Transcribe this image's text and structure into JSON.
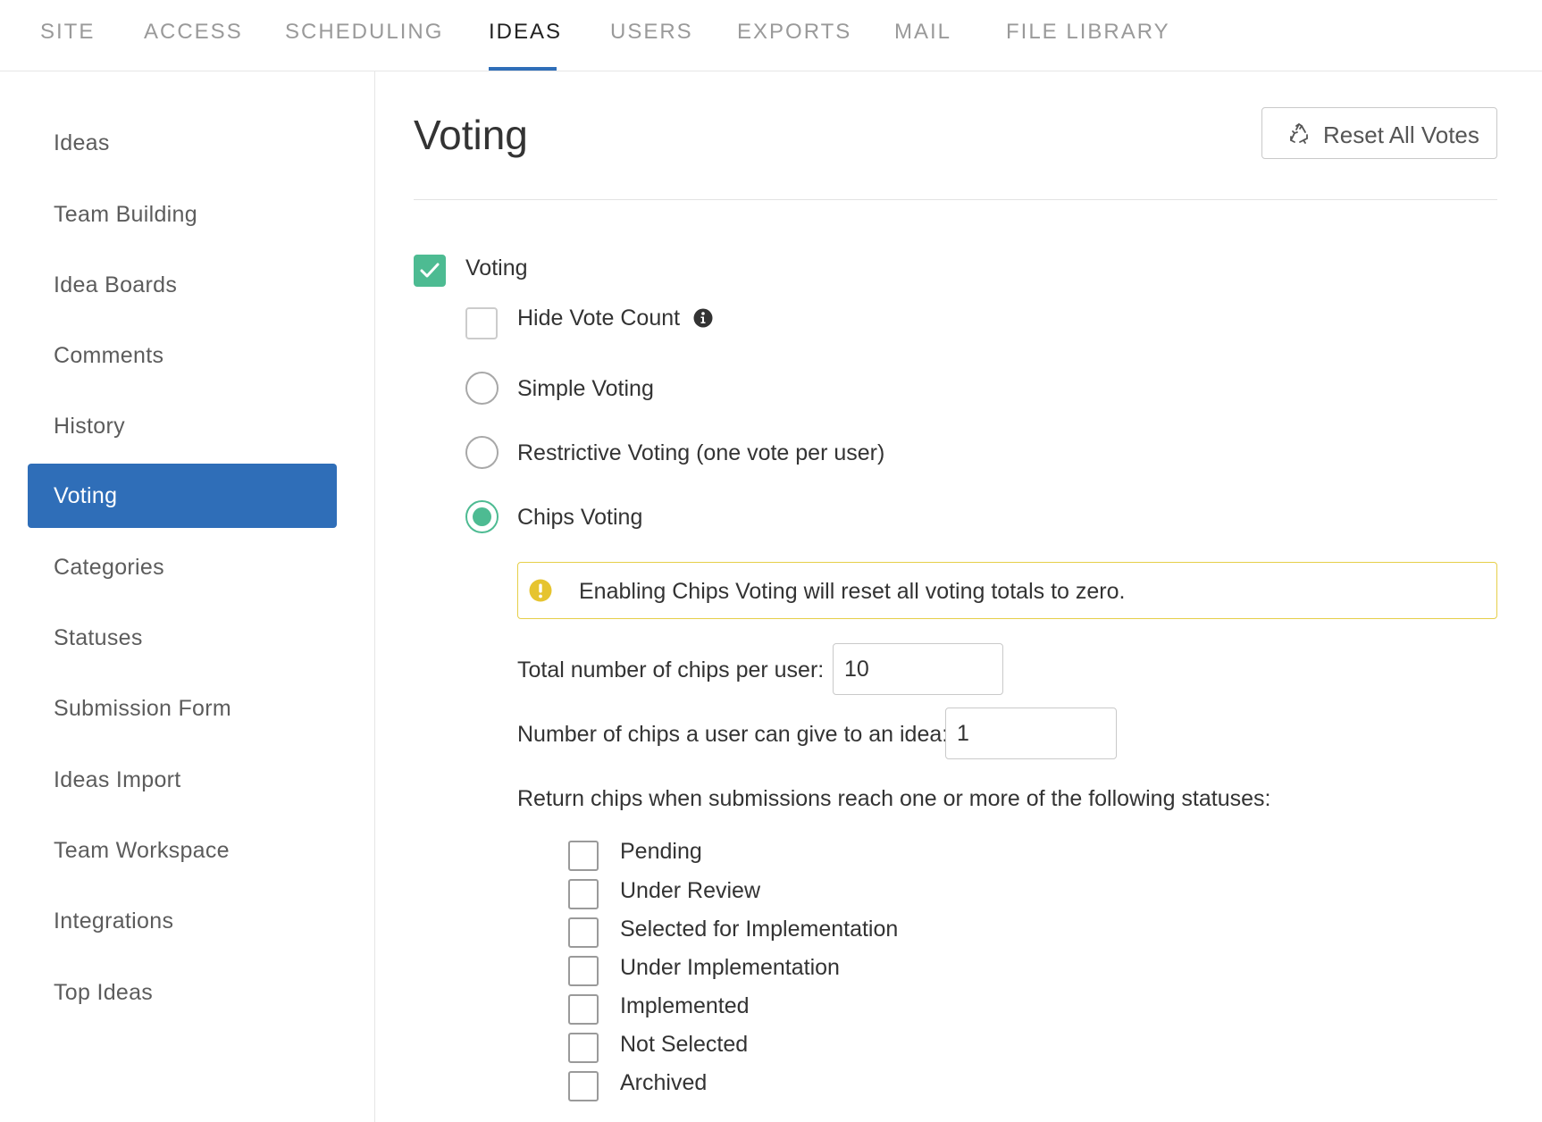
{
  "topnav": {
    "tabs": [
      {
        "label": "SITE"
      },
      {
        "label": "ACCESS"
      },
      {
        "label": "SCHEDULING"
      },
      {
        "label": "IDEAS"
      },
      {
        "label": "USERS"
      },
      {
        "label": "EXPORTS"
      },
      {
        "label": "MAIL"
      },
      {
        "label": "FILE LIBRARY"
      }
    ],
    "active_tab": "IDEAS"
  },
  "sidebar": {
    "items": [
      {
        "label": "Ideas"
      },
      {
        "label": "Team Building"
      },
      {
        "label": "Idea Boards"
      },
      {
        "label": "Comments"
      },
      {
        "label": "History"
      },
      {
        "label": "Voting"
      },
      {
        "label": "Categories"
      },
      {
        "label": "Statuses"
      },
      {
        "label": "Submission Form"
      },
      {
        "label": "Ideas Import"
      },
      {
        "label": "Team Workspace"
      },
      {
        "label": "Integrations"
      },
      {
        "label": "Top Ideas"
      }
    ],
    "active_item": "Voting"
  },
  "main": {
    "title": "Voting",
    "reset_button": "Reset All Votes",
    "voting_label": "Voting",
    "voting_checked": true,
    "hide_vote_count_label": "Hide Vote Count",
    "hide_vote_count_checked": false,
    "voting_modes": [
      {
        "label": "Simple Voting",
        "selected": false
      },
      {
        "label": "Restrictive Voting (one vote per user)",
        "selected": false
      },
      {
        "label": "Chips Voting",
        "selected": true
      }
    ],
    "warning_text": "Enabling Chips Voting will reset all voting totals to zero.",
    "chips_per_user_label": "Total number of chips per user:",
    "chips_per_user_value": "10",
    "chips_per_idea_label": "Number of chips a user can give to an idea:",
    "chips_per_idea_value": "1",
    "return_chips_label": "Return chips when submissions reach one or more of the following statuses:",
    "statuses": [
      {
        "label": "Pending",
        "checked": false
      },
      {
        "label": "Under Review",
        "checked": false
      },
      {
        "label": "Selected for Implementation",
        "checked": false
      },
      {
        "label": "Under Implementation",
        "checked": false
      },
      {
        "label": "Implemented",
        "checked": false
      },
      {
        "label": "Not Selected",
        "checked": false
      },
      {
        "label": "Archived",
        "checked": false
      }
    ]
  },
  "colors": {
    "accent_blue": "#2f6eb8",
    "check_green": "#4dbb92",
    "warning_yellow": "#e6cf49"
  },
  "icons": {
    "reset_button_icon": "recycle-icon",
    "hide_vote_count_icon": "info-icon",
    "warning_icon": "exclamation-circle-icon"
  }
}
